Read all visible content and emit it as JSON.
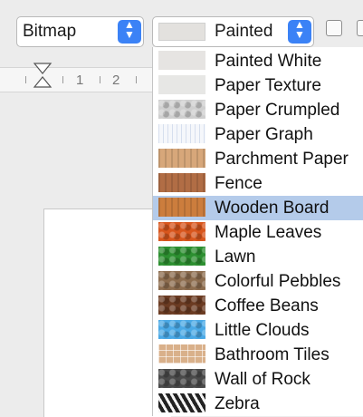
{
  "toolbar": {
    "fill_type": "Bitmap",
    "bitmap_style": "Painted"
  },
  "ruler": {
    "numbers": [
      "1",
      "2"
    ]
  },
  "colors": {
    "accent": "#3b82f6",
    "selection": "#b4cbea"
  },
  "dropdown": {
    "selected": "Wooden Board",
    "items": [
      {
        "label": "Painted White",
        "swatch": "#e6e4e2"
      },
      {
        "label": "Paper Texture",
        "swatch": "#e7e7e5"
      },
      {
        "label": "Paper Crumpled",
        "swatch": "#cfcfcf"
      },
      {
        "label": "Paper Graph",
        "swatch": "#f5f7fb"
      },
      {
        "label": "Parchment Paper",
        "swatch": "#d7a77a"
      },
      {
        "label": "Fence",
        "swatch": "#b16d45"
      },
      {
        "label": "Wooden Board",
        "swatch": "#cc7d3d"
      },
      {
        "label": "Maple Leaves",
        "swatch": "#d8561d"
      },
      {
        "label": "Lawn",
        "swatch": "#2c8f30"
      },
      {
        "label": "Colorful Pebbles",
        "swatch": "#8d6d4f"
      },
      {
        "label": "Coffee Beans",
        "swatch": "#6b3b22"
      },
      {
        "label": "Little Clouds",
        "swatch": "#4aa9e6"
      },
      {
        "label": "Bathroom Tiles",
        "swatch": "#d9b08a"
      },
      {
        "label": "Wall of Rock",
        "swatch": "#4a4a4a"
      },
      {
        "label": "Zebra",
        "swatch": "#2a2a2a"
      }
    ]
  }
}
